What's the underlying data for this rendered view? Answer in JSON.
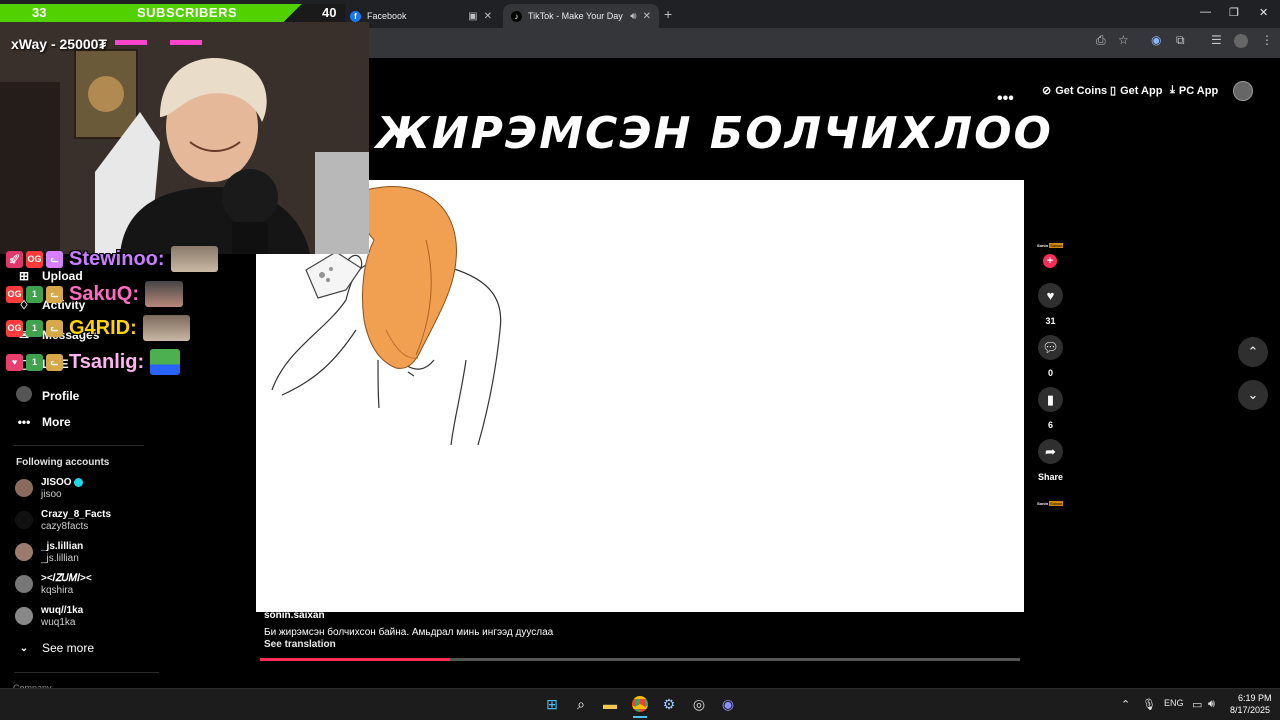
{
  "browser": {
    "tabs": [
      {
        "title": "Facebook",
        "icon": "facebook-icon"
      },
      {
        "title": "TikTok - Make Your Day",
        "icon": "tiktok-icon",
        "active": true
      }
    ]
  },
  "stream": {
    "subscribers_current": "33",
    "subscribers_label": "SUBSCRIBERS",
    "subscribers_goal": "40",
    "subscribers_progress": 0.825,
    "name": "xWay - 25000₮"
  },
  "chat": [
    {
      "user": "Stewinoo:",
      "color": "#c77dff",
      "badges": [
        "rocket",
        "OG",
        "cat"
      ]
    },
    {
      "user": "SakuQ:",
      "color": "#ff6bc1",
      "badges": [
        "OG",
        "1st",
        "cat"
      ]
    },
    {
      "user": "G4RID:",
      "color": "#ffd400",
      "badges": [
        "OG",
        "1st",
        "cat"
      ]
    },
    {
      "user": "Tsanlig:",
      "color": "#ffb3f0",
      "badges": [
        "heart",
        "1st",
        "cat"
      ]
    }
  ],
  "sidebar": {
    "items": [
      {
        "label": "Upload",
        "icon": "plus-icon"
      },
      {
        "label": "Activity",
        "icon": "bell-icon"
      },
      {
        "label": "Messages",
        "icon": "message-icon"
      },
      {
        "label": "LIVE",
        "icon": "live-icon"
      },
      {
        "label": "Profile",
        "icon": "profile-icon"
      },
      {
        "label": "More",
        "icon": "more-icon"
      }
    ],
    "following_title": "Following accounts",
    "accounts": [
      {
        "name": "JISOO",
        "handle": "jisoo",
        "verified": true
      },
      {
        "name": "Crazy_8_Facts",
        "handle": "cazy8facts"
      },
      {
        "name": "_js.lillian",
        "handle": "_js.lillian"
      },
      {
        "name": "><𝐼𝑍𝑈𝑀𝐼><",
        "handle": "kqshira"
      },
      {
        "name": "wuq//1ka",
        "handle": "wuq1ka"
      }
    ],
    "see_more": "See more",
    "company": "Company"
  },
  "header": {
    "get_coins": "Get Coins",
    "get_app": "Get App",
    "pc_app": "PC App"
  },
  "video": {
    "title": "ЖИРЭМСЭН  БОЛЧИХЛОО",
    "caption_user": "sonin.saixan",
    "caption_text": "Би жирэмсэн болчихсон байна. Амьдрал минь ингээд дууслаа",
    "see_translation": "See translation",
    "progress": 0.25
  },
  "actions": {
    "likes": "31",
    "comments": "0",
    "saves": "6",
    "share": "Share",
    "mini_logo_text": "Sonin",
    "mini_logo_badge": "Saixan"
  },
  "taskbar": {
    "lang": "ENG",
    "time": "6:19 PM",
    "date": "8/17/2025"
  }
}
